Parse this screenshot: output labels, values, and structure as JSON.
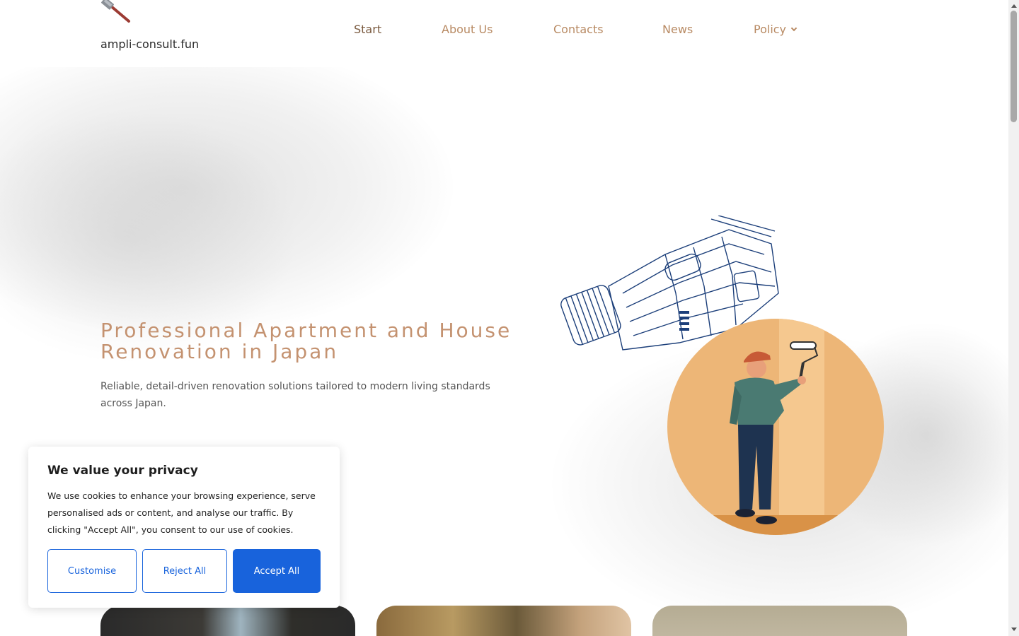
{
  "header": {
    "site_name": "ampli-consult.fun",
    "logo_icon": "hammer-icon",
    "nav": [
      {
        "label": "Start",
        "active": true
      },
      {
        "label": "About Us",
        "active": false
      },
      {
        "label": "Contacts",
        "active": false
      },
      {
        "label": "News",
        "active": false
      },
      {
        "label": "Policy",
        "active": false,
        "dropdown": true
      }
    ]
  },
  "hero": {
    "title": "Professional Apartment and House Renovation in Japan",
    "subtitle": "Reliable, detail-driven renovation solutions tailored to modern living standards across Japan."
  },
  "cookie": {
    "title": "We value your privacy",
    "text": "We use cookies to enhance your browsing experience, serve personalised ads or content, and analyse our traffic. By clicking \"Accept All\", you consent to our use of cookies.",
    "customise_label": "Customise",
    "reject_label": "Reject All",
    "accept_label": "Accept All"
  },
  "colors": {
    "nav": "#b88a63",
    "nav_active": "#7a5a3f",
    "title": "#c49270",
    "accent_button": "#1863dc",
    "circle": "#edb677"
  }
}
